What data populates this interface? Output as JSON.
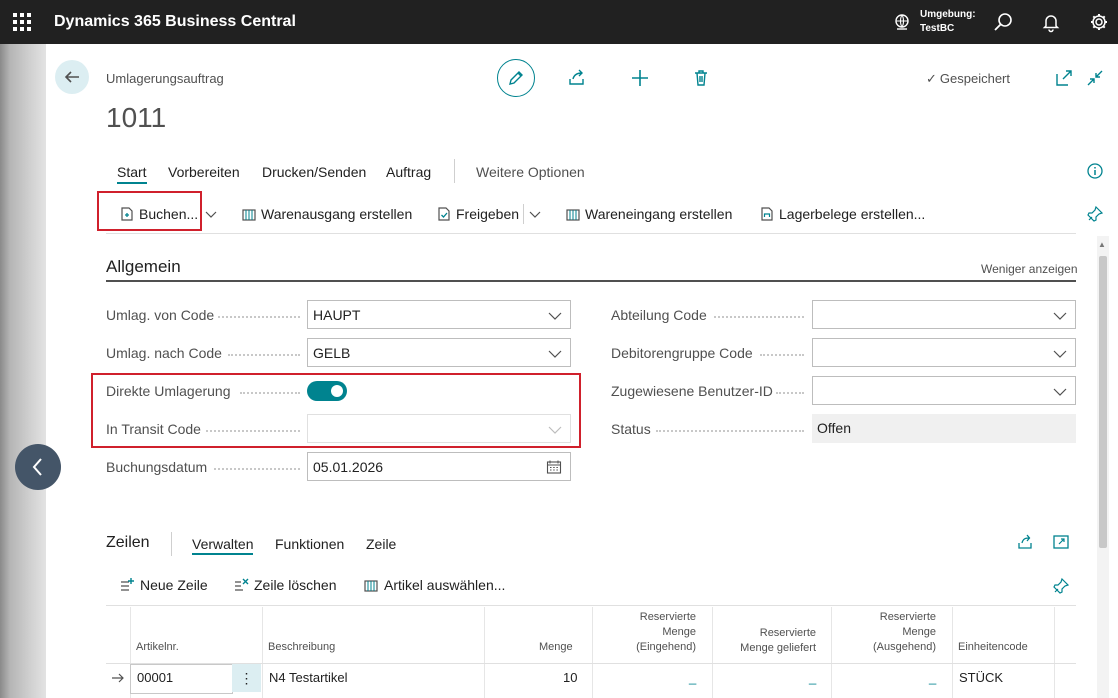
{
  "app": {
    "title": "Dynamics 365 Business Central",
    "environment_label": "Umgebung:",
    "environment_value": "TestBC"
  },
  "header": {
    "breadcrumb": "Umlagerungsauftrag",
    "record_no": "1011",
    "saved_label": "Gespeichert"
  },
  "tabs": [
    {
      "label": "Start"
    },
    {
      "label": "Vorbereiten"
    },
    {
      "label": "Drucken/Senden"
    },
    {
      "label": "Auftrag"
    },
    {
      "label": "Weitere Optionen"
    }
  ],
  "actions": {
    "post": "Buchen...",
    "create_shipment": "Warenausgang erstellen",
    "release": "Freigeben",
    "create_receipt": "Wareneingang erstellen",
    "create_whse_docs": "Lagerbelege erstellen..."
  },
  "general": {
    "title": "Allgemein",
    "show_less": "Weniger anzeigen",
    "fields": {
      "transfer_from": {
        "label": "Umlag. von Code",
        "value": "HAUPT"
      },
      "transfer_to": {
        "label": "Umlag. nach Code",
        "value": "GELB"
      },
      "direct_transfer": {
        "label": "Direkte Umlagerung",
        "on": true
      },
      "in_transit": {
        "label": "In Transit Code",
        "value": ""
      },
      "posting_date": {
        "label": "Buchungsdatum",
        "value": "05.01.2026"
      },
      "department": {
        "label": "Abteilung Code",
        "value": ""
      },
      "customer_group": {
        "label": "Debitorengruppe Code",
        "value": ""
      },
      "assigned_user": {
        "label": "Zugewiesene Benutzer-ID",
        "value": ""
      },
      "status": {
        "label": "Status",
        "value": "Offen"
      }
    }
  },
  "lines": {
    "title": "Zeilen",
    "tabs": [
      "Verwalten",
      "Funktionen",
      "Zeile"
    ],
    "actions": {
      "new_line": "Neue Zeile",
      "delete_line": "Zeile löschen",
      "select_items": "Artikel auswählen..."
    },
    "columns": {
      "item_no": "Artikelnr.",
      "description": "Beschreibung",
      "quantity": "Menge",
      "reserved_inbound_1": "Reservierte",
      "reserved_inbound_2": "Menge",
      "reserved_inbound_3": "(Eingehend)",
      "reserved_shipped_1": "Reservierte",
      "reserved_shipped_2": "Menge geliefert",
      "reserved_outbound_1": "Reservierte",
      "reserved_outbound_2": "Menge",
      "reserved_outbound_3": "(Ausgehend)",
      "uom": "Einheitencode"
    },
    "rows": [
      {
        "item_no": "00001",
        "description": "N4 Testartikel",
        "quantity": "10",
        "reserved_inbound": "_",
        "reserved_shipped": "_",
        "reserved_outbound": "_",
        "uom": "STÜCK",
        "row_menu": "⋮"
      }
    ]
  },
  "colors": {
    "accent": "#00838f",
    "appbar": "#212121",
    "highlight": "#d0202c"
  }
}
